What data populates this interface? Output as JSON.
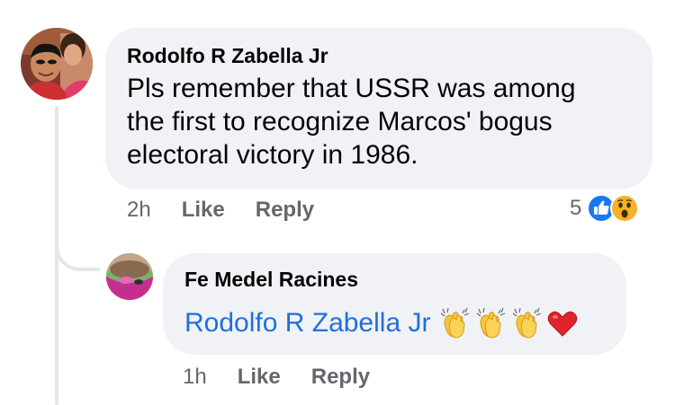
{
  "comment": {
    "author": "Rodolfo R Zabella Jr",
    "text": "Pls remember that USSR was among\nthe first to recognize Marcos' bogus\nelectoral victory in 1986.",
    "time": "2h",
    "like_label": "Like",
    "reply_label": "Reply",
    "reaction_count": "5",
    "reactions": [
      "like-icon",
      "wow-icon"
    ]
  },
  "reply": {
    "author": "Fe Medel Racines",
    "mention": "Rodolfo R Zabella Jr",
    "emojis": [
      "clapping-hands-icon",
      "clapping-hands-icon",
      "clapping-hands-icon",
      "red-heart-icon"
    ],
    "time": "1h",
    "like_label": "Like",
    "reply_label": "Reply"
  },
  "colors": {
    "bubble": "#f0f2f5",
    "link": "#216fdb",
    "secondary_text": "#65676b",
    "like_reaction": "#1877f2",
    "thread_line": "#e4e6eb"
  }
}
